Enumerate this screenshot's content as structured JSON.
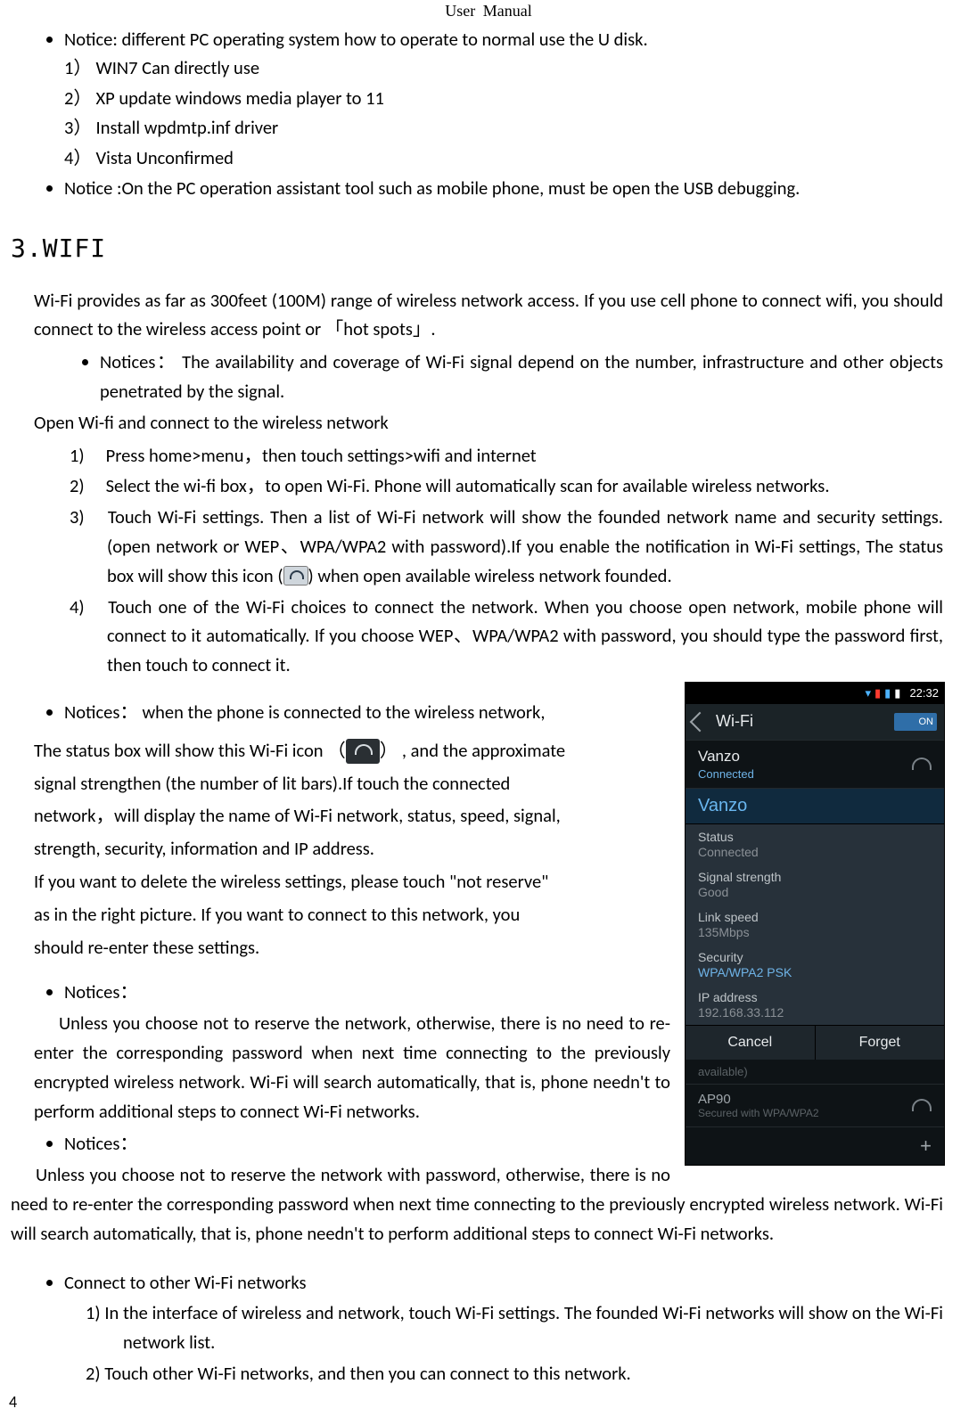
{
  "header": {
    "left": "User",
    "right": "Manual"
  },
  "top_notices": {
    "n1": "Notice: different PC operating system how to operate to normal use the U disk.",
    "os": {
      "1": "1） WIN7 Can directly use",
      "2": "2） XP update windows media player to 11",
      "3": "3） Install   wpdmtp.inf driver",
      "4": "4） Vista   Unconfirmed"
    },
    "n2": "Notice :On the PC operation assistant tool such as mobile phone, must be open the USB debugging."
  },
  "section_title": "3.WIFI",
  "wifi_intro": "Wi-Fi provides as far as 300feet (100M) range of wireless network access. If you use cell phone to connect  wifi, you should connect to the wireless access point or  「hot spots」.",
  "bul1": "Notices： The availability and coverage of Wi-Fi signal depend on the number, infrastructure and other objects penetrated by the signal.",
  "open_line": "Open Wi-fi and connect to the wireless network",
  "steps": {
    "s1": "Press home>menu，then touch settings>wifi and internet",
    "s2": "Select  the wi-fi box，to open Wi-Fi. Phone will automatically scan for available wireless networks.",
    "s3a": "Touch Wi-Fi settings. Then a list of Wi-Fi network will show the founded network name and security settings. (open network  or  WEP、WPA/WPA2 with password).If you enable the notification in Wi-Fi settings, The status box will show this icon (",
    "s3b": ") when open available wireless network founded.",
    "s4": "Touch one of the Wi-Fi choices to connect the network. When you choose open network, mobile phone will connect to it automatically. If you choose WEP、WPA/WPA2 with password, you should type the password first, then touch to connect   it."
  },
  "bul2": "Notices： when the phone is connected to the wireless network,",
  "p_after": {
    "l1a": "The status box will show this Wi-Fi icon （",
    "l1b": "） , and the approximate",
    "l2": "signal strengthen (the number of lit bars).If touch the connected",
    "l3": "network，will display the name of  Wi-Fi  network, status, speed,  signal,",
    "l4": "strength, security, information and IP address.",
    "l5": "If you want to delete the wireless settings, please touch \"not reserve\"",
    "l6": "as in the right picture. If you want to connect to this network, you",
    "l7": "should re-enter these settings."
  },
  "bul3": "Notices：",
  "p3": "Unless you choose not to reserve the network, otherwise, there is no need to re-enter the corresponding password when next time connecting to the previously encrypted wireless network. Wi-Fi will search automatically, that is, phone needn't to perform additional steps to connect Wi-Fi networks.",
  "bul4": "Notices：",
  "p4": "Unless you choose not to reserve the network with password, otherwise, there is no need to re-enter the corresponding password when next time connecting to the previously encrypted wireless network. Wi-Fi will search automatically, that is, phone needn't to perform additional steps to connect Wi-Fi networks.",
  "bul5": "Connect to other Wi-Fi networks",
  "other": {
    "o1": "In the interface of wireless and network, touch Wi-Fi settings. The founded Wi-Fi networks will show on the Wi-Fi network list.",
    "o2": "Touch other Wi-Fi networks, and then you can connect to this network."
  },
  "phone": {
    "time": "22:32",
    "title": "Wi-Fi",
    "on": "ON",
    "net": {
      "name": "Vanzo",
      "state": "Connected"
    },
    "sel": "Vanzo",
    "detail": {
      "status_k": "Status",
      "status_v": "Connected",
      "sig_k": "Signal strength",
      "sig_v": "Good",
      "spd_k": "Link speed",
      "spd_v": "135Mbps",
      "sec_k": "Security",
      "sec_v": "WPA/WPA2 PSK",
      "ip_k": "IP address",
      "ip_v": "192.168.33.112"
    },
    "btn": {
      "cancel": "Cancel",
      "forget": "Forget"
    },
    "dim": "available)",
    "ap": {
      "name": "AP90",
      "sub": "Secured with WPA/WPA2"
    }
  },
  "pagenum": "4"
}
